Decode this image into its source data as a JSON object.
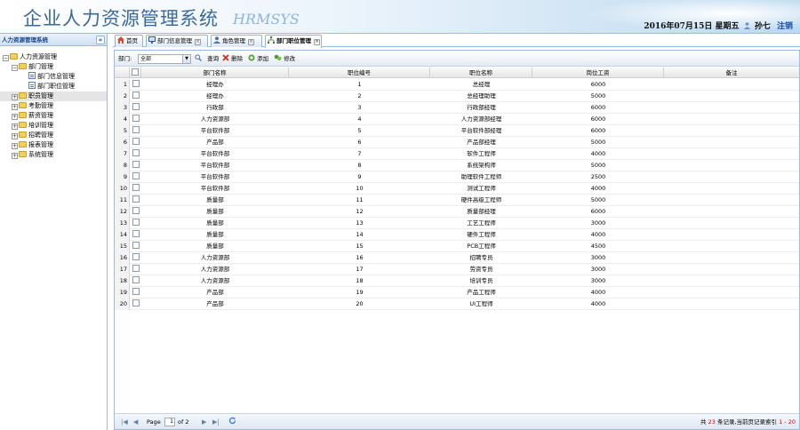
{
  "header": {
    "title": "企业人力资源管理系统",
    "logo_text": "HRMSYS",
    "date_text": "2016年07月15日 星期五",
    "username": "孙七",
    "logout_label": "注销"
  },
  "sidebar": {
    "title": "人力资源管理系统",
    "collapse_label": "«",
    "tree": {
      "root": "人力资源管理",
      "dept_mgmt": "部门管理",
      "dept_info": "部门信息管理",
      "dept_position": "部门职位管理",
      "staff_mgmt": "职员管理",
      "attendance_mgmt": "考勤管理",
      "salary_mgmt": "薪资管理",
      "training_mgmt": "培训管理",
      "recruit_mgmt": "招聘管理",
      "report_mgmt": "报表管理",
      "system_mgmt": "系统管理"
    }
  },
  "tabs": [
    {
      "label": "首页"
    },
    {
      "label": "部门信息管理",
      "close": "×"
    },
    {
      "label": "角色管理",
      "close": "×"
    },
    {
      "label": "部门职位管理",
      "close": "×"
    }
  ],
  "toolbar": {
    "dept_label": "部门:",
    "dept_value": "全部",
    "query_label": "查询",
    "delete_label": "删除",
    "add_label": "添加",
    "edit_label": "修改"
  },
  "grid": {
    "columns": [
      "部门名称",
      "职位编号",
      "职位名称",
      "岗位工资",
      "备注"
    ],
    "rows": [
      {
        "n": "1",
        "dept": "经理办",
        "id": "1",
        "pos": "总经理",
        "salary": "6000"
      },
      {
        "n": "2",
        "dept": "经理办",
        "id": "2",
        "pos": "总经理助理",
        "salary": "5000"
      },
      {
        "n": "3",
        "dept": "行政部",
        "id": "3",
        "pos": "行政部经理",
        "salary": "6000"
      },
      {
        "n": "4",
        "dept": "人力资源部",
        "id": "4",
        "pos": "人力资源部经理",
        "salary": "6000"
      },
      {
        "n": "5",
        "dept": "平台软件部",
        "id": "5",
        "pos": "平台软件部经理",
        "salary": "6000"
      },
      {
        "n": "6",
        "dept": "产品部",
        "id": "6",
        "pos": "产品部经理",
        "salary": "5000"
      },
      {
        "n": "7",
        "dept": "平台软件部",
        "id": "7",
        "pos": "软件工程师",
        "salary": "4000"
      },
      {
        "n": "8",
        "dept": "平台软件部",
        "id": "8",
        "pos": "系统架构师",
        "salary": "5000"
      },
      {
        "n": "9",
        "dept": "平台软件部",
        "id": "9",
        "pos": "助理软件工程师",
        "salary": "2500"
      },
      {
        "n": "10",
        "dept": "平台软件部",
        "id": "10",
        "pos": "测试工程师",
        "salary": "4000"
      },
      {
        "n": "11",
        "dept": "质量部",
        "id": "11",
        "pos": "硬件高级工程师",
        "salary": "5000"
      },
      {
        "n": "12",
        "dept": "质量部",
        "id": "12",
        "pos": "质量部经理",
        "salary": "6000"
      },
      {
        "n": "13",
        "dept": "质量部",
        "id": "13",
        "pos": "工艺工程师",
        "salary": "3000"
      },
      {
        "n": "14",
        "dept": "质量部",
        "id": "14",
        "pos": "硬件工程师",
        "salary": "4000"
      },
      {
        "n": "15",
        "dept": "质量部",
        "id": "15",
        "pos": "PCB工程师",
        "salary": "4500"
      },
      {
        "n": "16",
        "dept": "人力资源部",
        "id": "16",
        "pos": "招聘专员",
        "salary": "3000"
      },
      {
        "n": "17",
        "dept": "人力资源部",
        "id": "17",
        "pos": "劳资专员",
        "salary": "3000"
      },
      {
        "n": "18",
        "dept": "人力资源部",
        "id": "18",
        "pos": "培训专员",
        "salary": "3000"
      },
      {
        "n": "19",
        "dept": "产品部",
        "id": "19",
        "pos": "产品工程师",
        "salary": "4000"
      },
      {
        "n": "20",
        "dept": "产品部",
        "id": "20",
        "pos": "UI工程师",
        "salary": "4000"
      }
    ]
  },
  "pager": {
    "page_label": "Page",
    "page_value": "1",
    "of_label": "of 2",
    "info_prefix": "共",
    "total": "23",
    "info_middle": "条记录,当前页记录索引",
    "range": "1 - 20"
  },
  "colors": {
    "border": "#99bbe8",
    "link": "#1b4fa8",
    "highlight": "#d00000"
  }
}
